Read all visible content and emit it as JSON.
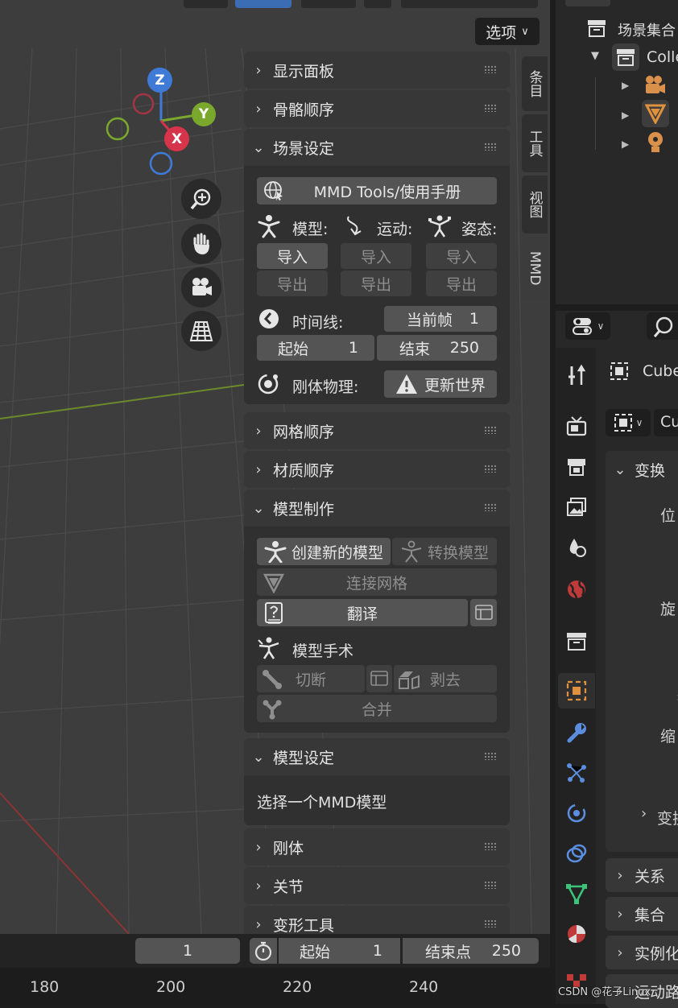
{
  "viewport": {
    "options_label": "选项",
    "gizmo": {
      "z": "Z",
      "y": "Y",
      "x": "X"
    }
  },
  "npanel": {
    "sections": {
      "display": "显示面板",
      "bones": "骨骼顺序",
      "scene": "场景设定",
      "mesh": "网格顺序",
      "material": "材质顺序",
      "model_make": "模型制作",
      "model_setting": "模型设定",
      "rigid": "刚体",
      "joint": "关节",
      "morph": "变形工具"
    },
    "manual_btn": "MMD Tools/使用手册",
    "model_lbl": "模型:",
    "motion_lbl": "运动:",
    "pose_lbl": "姿态:",
    "import": "导入",
    "export": "导出",
    "timeline_lbl": "时间线:",
    "current_frame_lbl": "当前帧",
    "current_frame": "1",
    "start_lbl": "起始",
    "start": "1",
    "end_lbl": "结束",
    "end": "250",
    "physics_lbl": "刚体物理:",
    "update_world": "更新世界",
    "create_model": "创建新的模型",
    "convert_model": "转换模型",
    "join_mesh": "连接网格",
    "translate": "翻译",
    "surgery_lbl": "模型手术",
    "cut": "切断",
    "peel": "剥去",
    "merge": "合并",
    "select_model_msg": "选择一个MMD模型"
  },
  "vtabs": [
    "条目",
    "工具",
    "视图",
    "MMD"
  ],
  "outliner": {
    "scene_collection": "场景集合",
    "collection": "Colle"
  },
  "props": {
    "object_name": "Cube",
    "data_name": "Cu",
    "transform": "变换",
    "location": "位",
    "rotation": "旋",
    "scale": "缩",
    "delta": "变换",
    "relations": "关系",
    "collections": "集合",
    "instancing": "实例化",
    "motion": "运动路"
  },
  "timeline": {
    "current": "1",
    "start_lbl": "起始",
    "start": "1",
    "end_lbl": "结束点",
    "end": "250",
    "ticks": [
      "180",
      "200",
      "220",
      "240"
    ]
  },
  "watermark": "CSDN @花子Linux"
}
